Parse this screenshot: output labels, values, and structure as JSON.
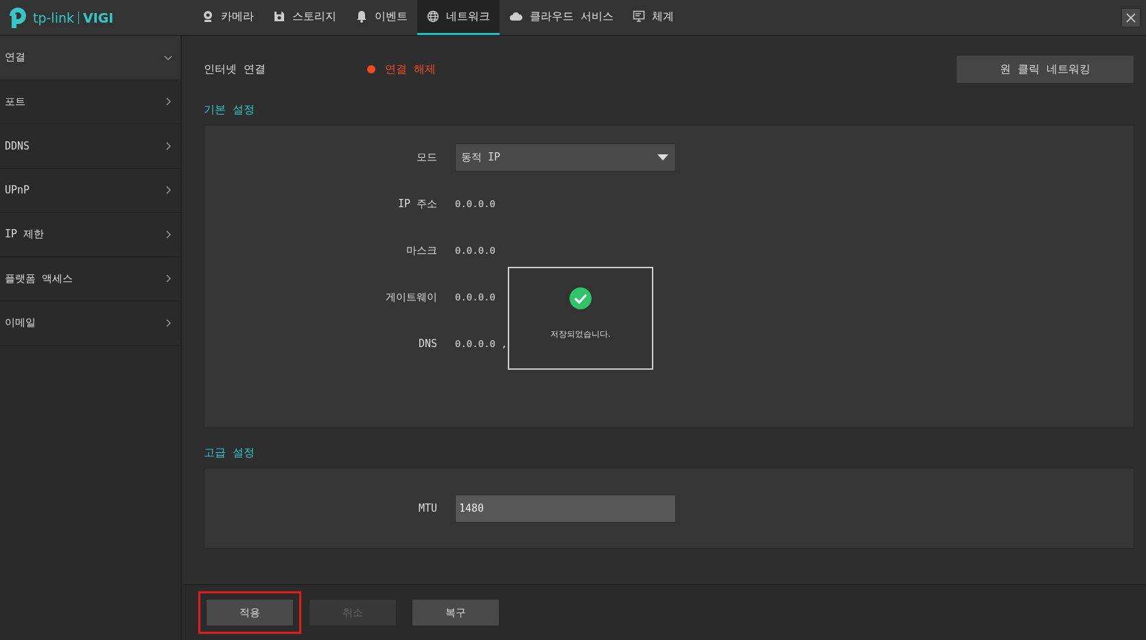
{
  "logo": {
    "brand": "tp-link",
    "product": "VIGI"
  },
  "nav_tabs": [
    {
      "label": "카메라",
      "selected": false
    },
    {
      "label": "스토리지",
      "selected": false
    },
    {
      "label": "이벤트",
      "selected": false
    },
    {
      "label": "네트워크",
      "selected": true
    },
    {
      "label": "클라우드 서비스",
      "selected": false
    },
    {
      "label": "체계",
      "selected": false
    }
  ],
  "sidebar": {
    "items": [
      {
        "label": "연결",
        "expanded": true
      },
      {
        "label": "포트",
        "expanded": false
      },
      {
        "label": "DDNS",
        "expanded": false
      },
      {
        "label": "UPnP",
        "expanded": false
      },
      {
        "label": "IP 제한",
        "expanded": false
      },
      {
        "label": "플랫폼 액세스",
        "expanded": false
      },
      {
        "label": "이메일",
        "expanded": false
      }
    ]
  },
  "internet": {
    "label": "인터넷 연결",
    "status": "연결 해제",
    "color": "#f04a24"
  },
  "one_click_button": "원 클릭 네트워킹",
  "basic_settings": {
    "title": "기본 설정",
    "mode": {
      "label": "모드",
      "value": "동적 IP"
    },
    "fields": [
      {
        "label": "IP 주소",
        "value": "0.0.0.0"
      },
      {
        "label": "마스크",
        "value": "0.0.0.0"
      },
      {
        "label": "게이트웨이",
        "value": "0.0.0.0"
      },
      {
        "label": "DNS",
        "value": "0.0.0.0 ,"
      }
    ]
  },
  "toast": {
    "message": "저장되었습니다."
  },
  "advanced_settings": {
    "title": "고급 설정",
    "mtu": {
      "label": "MTU",
      "value": "1480"
    }
  },
  "buttons": [
    {
      "label": "적용",
      "disabled": false,
      "highlighted": true
    },
    {
      "label": "취소",
      "disabled": true,
      "highlighted": false
    },
    {
      "label": "복구",
      "disabled": false,
      "highlighted": false
    }
  ]
}
